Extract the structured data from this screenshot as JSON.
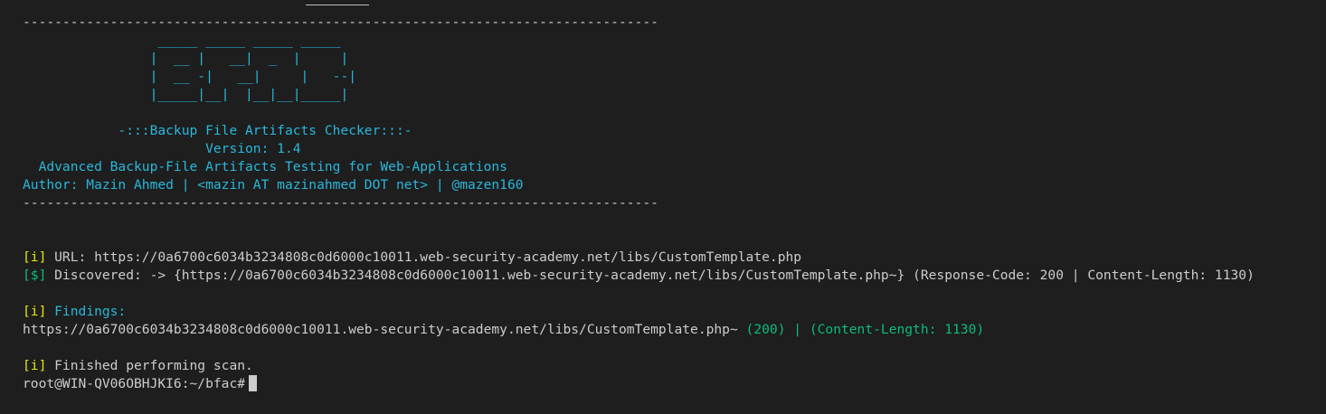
{
  "terminal": {
    "divider_top": "--------------------------------------------------------------------------------",
    "banner": {
      "art": [
        "                 _____ _____ _____ _____",
        "                |  __ |   __|  _  |     |",
        "                |  __ -|   __|     |   --|",
        "                |_____|__|  |__|__|_____|"
      ],
      "tagline": "            -:::Backup File Artifacts Checker:::-",
      "version": "                       Version: 1.4",
      "description": "  Advanced Backup-File Artifacts Testing for Web-Applications",
      "author": "Author: Mazin Ahmed | <mazin AT mazinahmed DOT net> | @mazen160"
    },
    "divider_bottom": "--------------------------------------------------------------------------------",
    "url_line": {
      "tag": "[i]",
      "text": " URL: https://0a6700c6034b3234808c0d6000c10011.web-security-academy.net/libs/CustomTemplate.php"
    },
    "discovered_line": {
      "tag": "[$]",
      "text": " Discovered: -> {https://0a6700c6034b3234808c0d6000c10011.web-security-academy.net/libs/CustomTemplate.php~} (Response-Code: 200 | Content-Length: 1130)"
    },
    "findings_header": {
      "tag": "[i]",
      "text": " Findings:"
    },
    "finding_result": {
      "url": "https://0a6700c6034b3234808c0d6000c10011.web-security-academy.net/libs/CustomTemplate.php~",
      "status": " (200) | (Content-Length: 1130)"
    },
    "finished_line": {
      "tag": "[i]",
      "text": " Finished performing scan."
    },
    "prompt": "root@WIN-QV06OBHJKI6:~/bfac#"
  },
  "colors": {
    "background": "#1e1e1e",
    "foreground": "#cccccc",
    "blue": "#29b8db",
    "yellow": "#e5e510",
    "green": "#0dbc79"
  }
}
